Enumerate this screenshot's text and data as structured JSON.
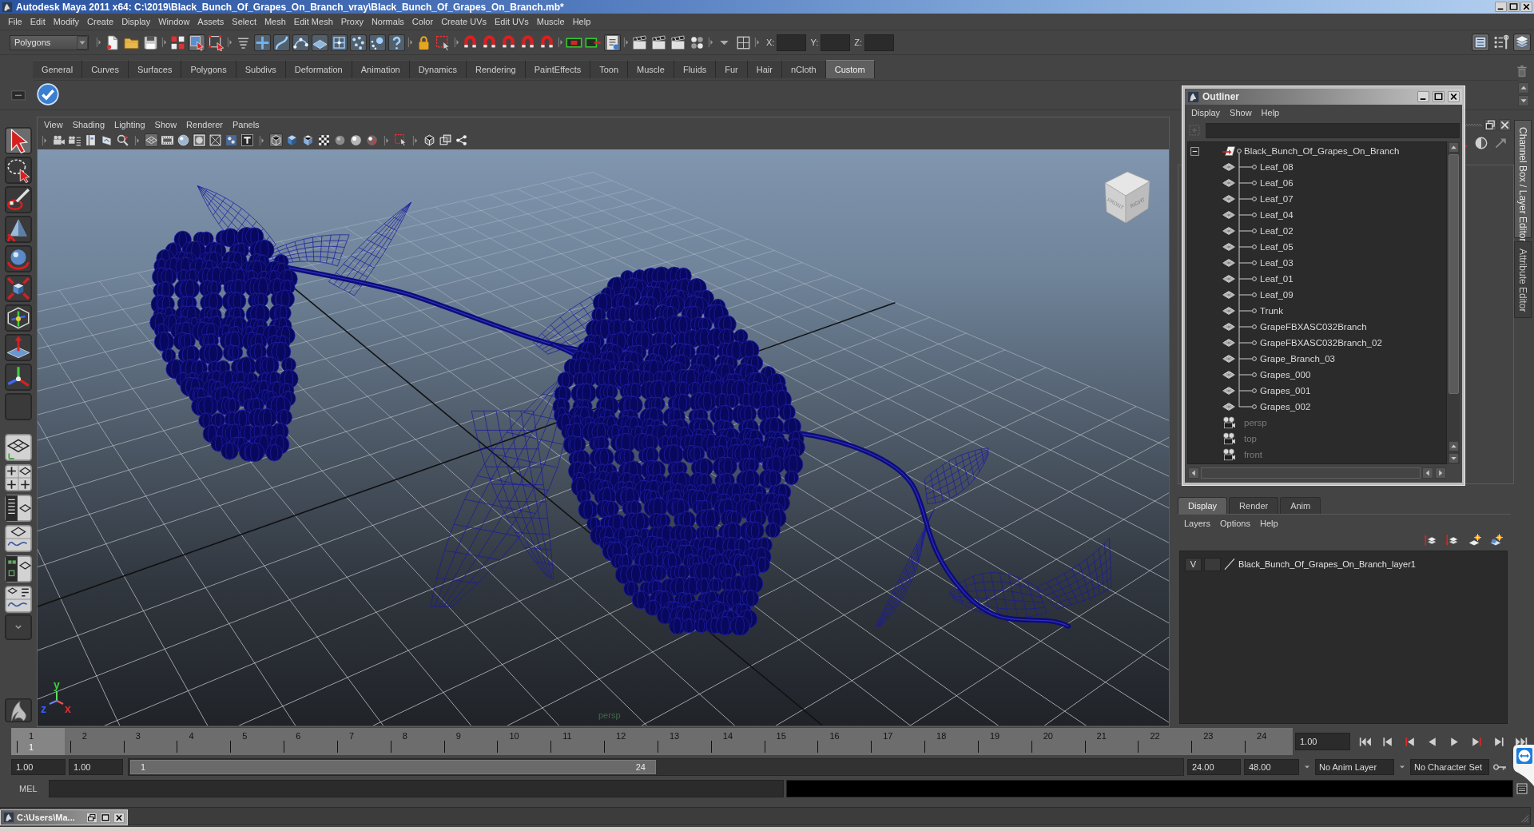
{
  "window": {
    "title": "Autodesk Maya 2011 x64: C:\\2019\\Black_Bunch_Of_Grapes_On_Branch_vray\\Black_Bunch_Of_Grapes_On_Branch.mb*"
  },
  "menu_bar": [
    "File",
    "Edit",
    "Modify",
    "Create",
    "Display",
    "Window",
    "Assets",
    "Select",
    "Mesh",
    "Edit Mesh",
    "Proxy",
    "Normals",
    "Color",
    "Create UVs",
    "Edit UVs",
    "Muscle",
    "Help"
  ],
  "status_line": {
    "mode": "Polygons",
    "coordinate_fields": [
      {
        "label": "X:"
      },
      {
        "label": "Y:"
      },
      {
        "label": "Z:"
      }
    ]
  },
  "shelf": {
    "tabs": [
      {
        "label": "General",
        "selected": false
      },
      {
        "label": "Curves",
        "selected": false
      },
      {
        "label": "Surfaces",
        "selected": false
      },
      {
        "label": "Polygons",
        "selected": false
      },
      {
        "label": "Subdivs",
        "selected": false
      },
      {
        "label": "Deformation",
        "selected": false
      },
      {
        "label": "Animation",
        "selected": false
      },
      {
        "label": "Dynamics",
        "selected": false
      },
      {
        "label": "Rendering",
        "selected": false
      },
      {
        "label": "PaintEffects",
        "selected": false
      },
      {
        "label": "Toon",
        "selected": false
      },
      {
        "label": "Muscle",
        "selected": false
      },
      {
        "label": "Fluids",
        "selected": false
      },
      {
        "label": "Fur",
        "selected": false
      },
      {
        "label": "Hair",
        "selected": false
      },
      {
        "label": "nCloth",
        "selected": false
      },
      {
        "label": "Custom",
        "selected": true
      }
    ]
  },
  "viewport": {
    "menus": [
      "View",
      "Shading",
      "Lighting",
      "Show",
      "Renderer",
      "Panels"
    ],
    "view_cube": [
      "FRONT",
      "RIGHT"
    ],
    "axis_labels": [
      {
        "label": "y",
        "color": "#3ccf3c"
      },
      {
        "label": "z",
        "color": "#3a5cff"
      },
      {
        "label": "x",
        "color": "#e03030"
      }
    ],
    "camera": "persp"
  },
  "outliner": {
    "title": "Outliner",
    "menus": [
      "Display",
      "Show",
      "Help"
    ],
    "items": [
      {
        "name": "Black_Bunch_Of_Grapes_On_Branch",
        "kind": "group",
        "expanded": true,
        "hidden": false,
        "children": [
          {
            "name": "Leaf_08",
            "kind": "mesh",
            "hidden": false
          },
          {
            "name": "Leaf_06",
            "kind": "mesh",
            "hidden": false
          },
          {
            "name": "Leaf_07",
            "kind": "mesh",
            "hidden": false
          },
          {
            "name": "Leaf_04",
            "kind": "mesh",
            "hidden": false
          },
          {
            "name": "Leaf_02",
            "kind": "mesh",
            "hidden": false
          },
          {
            "name": "Leaf_05",
            "kind": "mesh",
            "hidden": false
          },
          {
            "name": "Leaf_03",
            "kind": "mesh",
            "hidden": false
          },
          {
            "name": "Leaf_01",
            "kind": "mesh",
            "hidden": false
          },
          {
            "name": "Leaf_09",
            "kind": "mesh",
            "hidden": false
          },
          {
            "name": "Trunk",
            "kind": "mesh",
            "hidden": false
          },
          {
            "name": "GrapeFBXASC032Branch",
            "kind": "mesh",
            "hidden": false
          },
          {
            "name": "GrapeFBXASC032Branch_02",
            "kind": "mesh",
            "hidden": false
          },
          {
            "name": "Grape_Branch_03",
            "kind": "mesh",
            "hidden": false
          },
          {
            "name": "Grapes_000",
            "kind": "mesh",
            "hidden": false
          },
          {
            "name": "Grapes_001",
            "kind": "mesh",
            "hidden": false
          },
          {
            "name": "Grapes_002",
            "kind": "mesh",
            "hidden": false
          }
        ]
      },
      {
        "name": "persp",
        "kind": "camera",
        "hidden": true
      },
      {
        "name": "top",
        "kind": "camera",
        "hidden": true
      },
      {
        "name": "front",
        "kind": "camera",
        "hidden": true
      }
    ]
  },
  "side_tabs": [
    {
      "label": "Channel Box / Layer Editor",
      "selected": true
    },
    {
      "label": "Attribute Editor",
      "selected": false
    }
  ],
  "layer_editor": {
    "tabs": [
      {
        "label": "Display",
        "selected": true
      },
      {
        "label": "Render",
        "selected": false
      },
      {
        "label": "Anim",
        "selected": false
      }
    ],
    "menus": [
      "Layers",
      "Options",
      "Help"
    ],
    "layers": [
      {
        "visibility": "V",
        "name": "Black_Bunch_Of_Grapes_On_Branch_layer1"
      }
    ]
  },
  "time_slider": {
    "frames": [
      {
        "label": "1",
        "selected": true
      },
      {
        "label": "2",
        "selected": false
      },
      {
        "label": "3",
        "selected": false
      },
      {
        "label": "4",
        "selected": false
      },
      {
        "label": "5",
        "selected": false
      },
      {
        "label": "6",
        "selected": false
      },
      {
        "label": "7",
        "selected": false
      },
      {
        "label": "8",
        "selected": false
      },
      {
        "label": "9",
        "selected": false
      },
      {
        "label": "10",
        "selected": false
      },
      {
        "label": "11",
        "selected": false
      },
      {
        "label": "12",
        "selected": false
      },
      {
        "label": "13",
        "selected": false
      },
      {
        "label": "14",
        "selected": false
      },
      {
        "label": "15",
        "selected": false
      },
      {
        "label": "16",
        "selected": false
      },
      {
        "label": "17",
        "selected": false
      },
      {
        "label": "18",
        "selected": false
      },
      {
        "label": "19",
        "selected": false
      },
      {
        "label": "20",
        "selected": false
      },
      {
        "label": "21",
        "selected": false
      },
      {
        "label": "22",
        "selected": false
      },
      {
        "label": "23",
        "selected": false
      },
      {
        "label": "24",
        "selected": false
      }
    ],
    "current_frame": "1",
    "current_time": "1.00"
  },
  "range_slider": {
    "start_time": "1.00",
    "playback_start": "1.00",
    "range_start": "1",
    "range_end": "24",
    "level": 0.5,
    "playback_end": "24.00",
    "end_time": "48.00",
    "anim_layer": "No Anim Layer",
    "character_set": "No Character Set"
  },
  "command_line": {
    "language": "MEL"
  },
  "minimized_window": {
    "title": "C:\\Users\\Ma..."
  }
}
